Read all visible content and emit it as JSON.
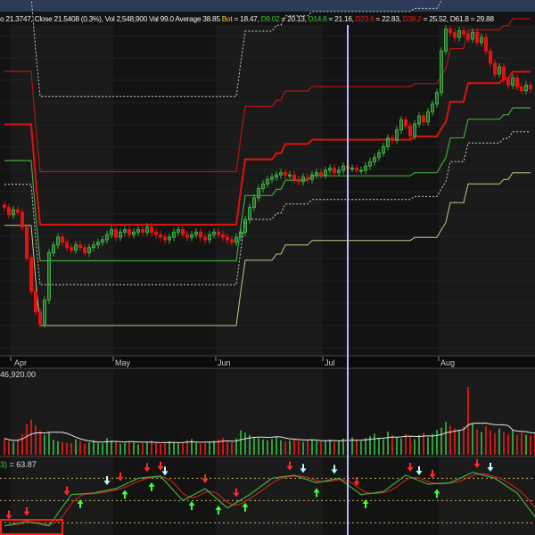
{
  "header": {
    "segments": [
      {
        "text": "o 21.3747, Close 21.5408 (0.3%), Vol 2,548,900 Val 99.0 Average 38.85 ",
        "color": "w"
      },
      {
        "text": "Bot",
        "color": "y"
      },
      {
        "text": " = 18.47, ",
        "color": "w"
      },
      {
        "text": "D9.02",
        "color": "g"
      },
      {
        "text": " = 20.13, ",
        "color": "w"
      },
      {
        "text": "D14.6",
        "color": "g"
      },
      {
        "text": " = 21.16, ",
        "color": "w"
      },
      {
        "text": "D23.6",
        "color": "r"
      },
      {
        "text": " = 22.83, ",
        "color": "w"
      },
      {
        "text": "D38.2",
        "color": "r"
      },
      {
        "text": " = 25.52, ",
        "color": "w"
      },
      {
        "text": "D61.8",
        "color": "w"
      },
      {
        "text": " = 29.88",
        "color": "w"
      }
    ]
  },
  "volume_label": "46,920.00",
  "oscillator_label": {
    "prefix": "3)",
    "value": " = 63.87"
  },
  "colors": {
    "up": "#3cb043",
    "down": "#e81010",
    "bot": "#c8c88a",
    "dotted": "#cfcfcf",
    "green": "#3fa63f",
    "red_thick": "#e01010",
    "red_thin": "#b01515",
    "cursor": "#b8b8ff"
  },
  "chart_data": [
    {
      "type": "candlestick",
      "title": "Price with Fibonacci levels",
      "scale": "log",
      "x_ticks": [
        {
          "label": "Apr",
          "day": 2
        },
        {
          "label": "May",
          "day": 25
        },
        {
          "label": "Jun",
          "day": 48
        },
        {
          "label": "Jul",
          "day": 72
        },
        {
          "label": "Aug",
          "day": 98
        }
      ],
      "cursor_day": 77,
      "first_open": 19.9,
      "close": [
        19.8,
        19.5,
        19.7,
        19.6,
        19.0,
        17.8,
        16.6,
        15.9,
        15.5,
        16.3,
        18.0,
        18.3,
        18.6,
        18.4,
        18.2,
        18.1,
        18.3,
        18.2,
        18.0,
        18.2,
        18.3,
        18.4,
        18.5,
        18.7,
        18.9,
        18.6,
        18.8,
        18.9,
        18.7,
        18.8,
        18.9,
        18.8,
        19.0,
        18.8,
        18.7,
        18.6,
        18.5,
        18.6,
        18.8,
        18.9,
        18.7,
        18.6,
        18.7,
        18.8,
        18.6,
        18.5,
        18.7,
        18.8,
        18.7,
        18.6,
        18.5,
        18.4,
        18.6,
        18.8,
        19.3,
        19.8,
        20.2,
        20.6,
        20.8,
        21.0,
        21.1,
        21.2,
        21.3,
        21.2,
        21.2,
        21.0,
        20.9,
        21.1,
        21.0,
        21.2,
        21.3,
        21.2,
        21.4,
        21.5,
        21.3,
        21.4,
        21.6,
        21.5,
        21.5,
        21.4,
        21.4,
        21.6,
        21.8,
        22.0,
        22.2,
        22.5,
        22.9,
        22.8,
        23.3,
        23.8,
        23.5,
        23.0,
        23.6,
        24.0,
        23.7,
        24.2,
        24.6,
        25.2,
        27.5,
        28.8,
        28.6,
        28.3,
        28.7,
        28.5,
        28.2,
        28.6,
        28.0,
        28.3,
        27.5,
        26.8,
        26.2,
        26.6,
        25.9,
        25.6,
        26.0,
        25.5,
        25.3,
        25.6,
        25.4
      ],
      "bot_steps": [
        [
          0,
          19.07
        ],
        [
          7,
          17.0
        ],
        [
          8,
          15.45
        ],
        [
          53,
          16.6
        ],
        [
          54,
          17.72
        ],
        [
          61,
          17.95
        ],
        [
          63,
          18.3
        ],
        [
          69,
          18.47
        ],
        [
          92,
          18.59
        ],
        [
          98,
          18.9
        ],
        [
          99,
          19.18
        ],
        [
          100,
          20.0
        ],
        [
          104,
          20.8
        ],
        [
          112,
          21.0
        ],
        [
          114,
          21.3
        ]
      ],
      "levels": [
        {
          "name": "Bot",
          "value": 18.47,
          "style": "bot"
        },
        {
          "name": "D9.02",
          "value": 20.13,
          "style": "dotted"
        },
        {
          "name": "D14.6",
          "value": 21.16,
          "style": "green"
        },
        {
          "name": "D23.6",
          "value": 22.83,
          "style": "red_thick"
        },
        {
          "name": "D38.2",
          "value": 25.52,
          "style": "red_thin"
        },
        {
          "name": "D61.8",
          "value": 29.88,
          "style": "dotted"
        }
      ]
    },
    {
      "type": "bar",
      "title": "Volume",
      "ymax": 46920,
      "values": [
        9800,
        8200,
        7600,
        9100,
        12500,
        18300,
        21000,
        17500,
        14200,
        11800,
        13500,
        9000,
        8200,
        7600,
        7100,
        6800,
        9200,
        8100,
        6500,
        7400,
        8800,
        7200,
        6900,
        9900,
        8400,
        7800,
        6600,
        7000,
        8300,
        7500,
        6200,
        6900,
        7700,
        8600,
        7300,
        6400,
        7100,
        8000,
        7600,
        6800,
        7200,
        8800,
        9400,
        7100,
        6500,
        7000,
        7800,
        8300,
        9100,
        10200,
        8700,
        7600,
        9800,
        14500,
        13200,
        11800,
        10600,
        9900,
        9200,
        8600,
        9400,
        10800,
        8800,
        7900,
        8400,
        9600,
        8200,
        7700,
        8900,
        9300,
        8100,
        7600,
        8500,
        9000,
        7800,
        8300,
        9700,
        8600,
        10400,
        9100,
        8200,
        9800,
        11200,
        12600,
        10100,
        9300,
        13800,
        11500,
        10200,
        9700,
        12300,
        10800,
        9400,
        11900,
        13100,
        10600,
        12400,
        14800,
        16200,
        19500,
        17400,
        15800,
        14300,
        16900,
        40500,
        18800,
        15200,
        13600,
        17100,
        14400,
        12900,
        15600,
        13800,
        12200,
        14700,
        11900,
        13300,
        12100,
        11400,
        12800
      ]
    },
    {
      "type": "line",
      "title": "Stochastic oscillator",
      "ylim": [
        0,
        100
      ],
      "reference_lines": [
        20,
        50,
        80
      ],
      "sample_every_days": 5,
      "k": [
        16,
        22,
        16,
        58,
        60,
        66,
        80,
        83,
        50,
        66,
        40,
        58,
        80,
        84,
        74,
        80,
        58,
        62,
        84,
        72,
        74,
        88,
        80,
        60,
        20
      ],
      "signals": [
        {
          "day": 1,
          "dir": "down",
          "color": "red"
        },
        {
          "day": 5,
          "dir": "down",
          "color": "red"
        },
        {
          "day": 14,
          "dir": "down",
          "color": "red"
        },
        {
          "day": 26,
          "dir": "down",
          "color": "red"
        },
        {
          "day": 32,
          "dir": "down",
          "color": "red"
        },
        {
          "day": 35,
          "dir": "down",
          "color": "red"
        },
        {
          "day": 45,
          "dir": "down",
          "color": "red"
        },
        {
          "day": 52,
          "dir": "down",
          "color": "red"
        },
        {
          "day": 64,
          "dir": "down",
          "color": "red"
        },
        {
          "day": 79,
          "dir": "down",
          "color": "red"
        },
        {
          "day": 91,
          "dir": "down",
          "color": "red"
        },
        {
          "day": 96,
          "dir": "down",
          "color": "red"
        },
        {
          "day": 106,
          "dir": "down",
          "color": "red"
        },
        {
          "day": 23,
          "dir": "down",
          "color": "cyan"
        },
        {
          "day": 36,
          "dir": "down",
          "color": "cyan"
        },
        {
          "day": 67,
          "dir": "down",
          "color": "cyan"
        },
        {
          "day": 74,
          "dir": "down",
          "color": "cyan"
        },
        {
          "day": 93,
          "dir": "down",
          "color": "cyan"
        },
        {
          "day": 109,
          "dir": "down",
          "color": "cyan"
        },
        {
          "day": 17,
          "dir": "up",
          "color": "green"
        },
        {
          "day": 27,
          "dir": "up",
          "color": "green"
        },
        {
          "day": 33,
          "dir": "up",
          "color": "green"
        },
        {
          "day": 42,
          "dir": "up",
          "color": "green"
        },
        {
          "day": 48,
          "dir": "up",
          "color": "green"
        },
        {
          "day": 54,
          "dir": "up",
          "color": "green"
        },
        {
          "day": 70,
          "dir": "up",
          "color": "green"
        },
        {
          "day": 81,
          "dir": "up",
          "color": "green"
        },
        {
          "day": 97,
          "dir": "up",
          "color": "green"
        }
      ]
    }
  ]
}
